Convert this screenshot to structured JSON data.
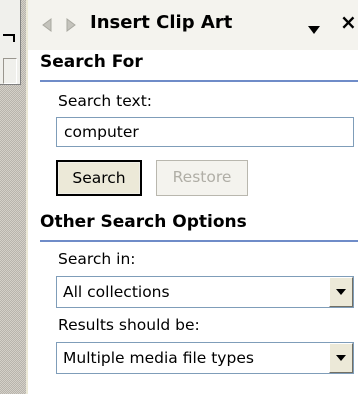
{
  "pane": {
    "title": "Insert Clip Art",
    "close_glyph": "×"
  },
  "search_for": {
    "heading": "Search For",
    "search_text_label": "Search text:",
    "search_text_value": "computer",
    "search_button": "Search",
    "restore_button": "Restore"
  },
  "other_options": {
    "heading": "Other Search Options",
    "search_in_label": "Search in:",
    "search_in_value": "All collections",
    "results_label": "Results should be:",
    "results_value": "Multiple media file types"
  },
  "colors": {
    "section_underline": "#6f8cc8",
    "input_border": "#7f9db9",
    "button_face": "#ece9d8"
  },
  "icons": {
    "back": "back-arrow-icon",
    "forward": "forward-arrow-icon",
    "menu": "dropdown-triangle-icon",
    "close": "close-icon"
  }
}
